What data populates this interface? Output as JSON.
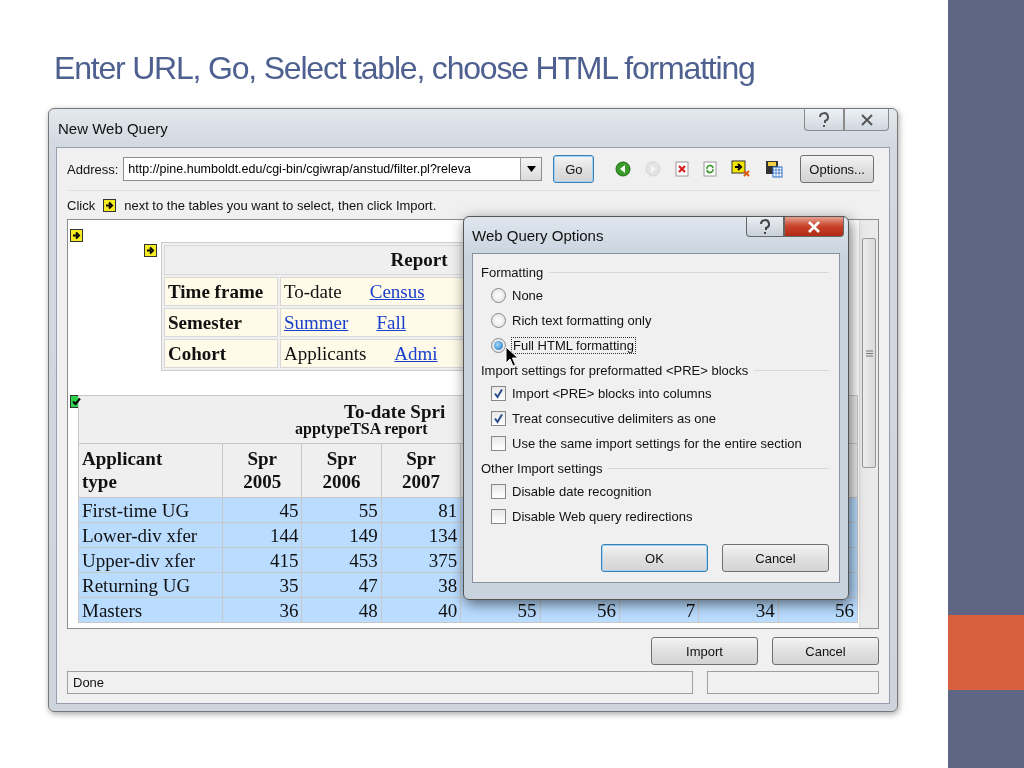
{
  "slide": {
    "title": "Enter URL, Go, Select table, choose HTML formatting"
  },
  "web_query": {
    "title": "New Web Query",
    "address_label": "Address:",
    "address": "http://pine.humboldt.edu/cgi-bin/cgiwrap/anstud/filter.pl?releva",
    "go": "Go",
    "toolbar": [
      {
        "kind": "back",
        "disabled": false
      },
      {
        "kind": "forward",
        "disabled": true
      },
      {
        "kind": "stop",
        "disabled": false
      },
      {
        "kind": "refresh",
        "disabled": false
      },
      {
        "kind": "hide-icons",
        "disabled": false
      },
      {
        "kind": "save",
        "disabled": false
      }
    ],
    "options": "Options...",
    "hint_start": "Click",
    "hint_end": "next to the tables you want to select, then click Import.",
    "page": {
      "selected": false,
      "report": {
        "selected": false,
        "title": "Report",
        "rows": [
          {
            "label": "Time frame",
            "values": [
              {
                "text": "To-date",
                "kind": "text"
              },
              {
                "text": "Census",
                "kind": "link"
              }
            ]
          },
          {
            "label": "Semester",
            "values": [
              {
                "text": "Summer",
                "kind": "link"
              },
              {
                "text": "Fall",
                "kind": "link"
              }
            ]
          },
          {
            "label": "Cohort",
            "values": [
              {
                "text": "Applicants",
                "kind": "text"
              },
              {
                "text": "Admi",
                "kind": "link"
              }
            ]
          }
        ]
      },
      "table": {
        "selected": true,
        "title": "To-date Spri",
        "subtitle": "apptypeTSA report",
        "columns": [
          "Applicant type",
          "Spr 2005",
          "Spr 2006",
          "Spr 2007"
        ],
        "rows": [
          {
            "cells": [
              "First-time UG",
              "45",
              "55",
              "81"
            ]
          },
          {
            "cells": [
              "Lower-div xfer",
              "144",
              "149",
              "134"
            ]
          },
          {
            "cells": [
              "Upper-div xfer",
              "415",
              "453",
              "375"
            ]
          },
          {
            "cells": [
              "Returning UG",
              "35",
              "47",
              "38"
            ]
          },
          {
            "cells": [
              "Masters",
              "36",
              "48",
              "40",
              "55",
              "56",
              "7",
              "34",
              "56"
            ]
          }
        ]
      }
    },
    "buttons": [
      "Import",
      "Cancel"
    ],
    "status": "Done"
  },
  "options_dialog": {
    "title": "Web Query Options",
    "groups": [
      {
        "label": "Formatting",
        "items": [
          {
            "kind": "radio",
            "label": "None",
            "selected": false
          },
          {
            "kind": "radio",
            "label": "Rich text formatting only",
            "selected": false
          },
          {
            "kind": "radio",
            "label": "Full HTML formatting",
            "selected": true
          }
        ]
      },
      {
        "label": "Import settings for preformatted <PRE> blocks",
        "items": [
          {
            "kind": "checkbox",
            "label": "Import <PRE> blocks into columns",
            "checked": true
          },
          {
            "kind": "checkbox",
            "label": "Treat consecutive delimiters as one",
            "checked": true
          },
          {
            "kind": "checkbox",
            "label": "Use the same import settings for the entire section",
            "checked": false
          }
        ]
      },
      {
        "label": "Other Import settings",
        "items": [
          {
            "kind": "checkbox",
            "label": "Disable date recognition",
            "checked": false
          },
          {
            "kind": "checkbox",
            "label": "Disable Web query redirections",
            "checked": false
          }
        ]
      }
    ],
    "buttons": [
      "OK",
      "Cancel"
    ]
  }
}
